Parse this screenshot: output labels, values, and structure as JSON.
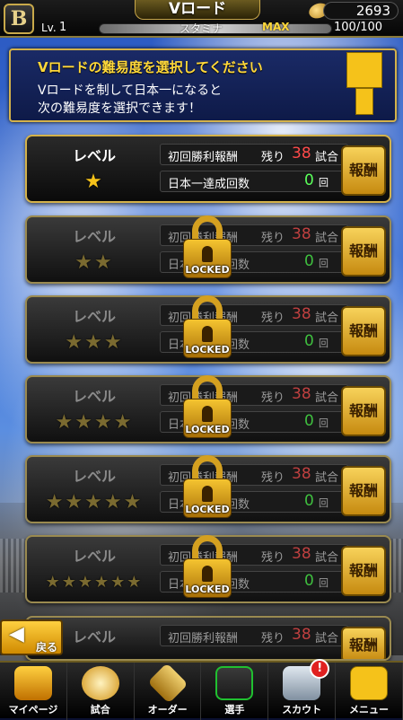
{
  "header": {
    "logo": "B",
    "title": "Vロード",
    "coins": "2693",
    "level_label": "Lv.",
    "level_value": "1",
    "stamina_label": "スタミナ",
    "stamina_max": "MAX",
    "stamina_value": "100/100"
  },
  "info": {
    "heading": "Vロードの難易度を選択してください",
    "line1": "Vロードを制して日本一になると",
    "line2": "次の難易度を選択できます！"
  },
  "levels": [
    {
      "label": "レベル",
      "stars": "★",
      "row1_label": "初回勝利報酬",
      "remaining_label": "残り",
      "remaining": "38",
      "remaining_unit": "試合",
      "row2_label": "日本一達成回数",
      "wins": "0",
      "wins_unit": "回",
      "reward": "報酬"
    },
    {
      "label": "レベル",
      "stars": "★★",
      "row1_label": "初回勝利報酬",
      "remaining_label": "残り",
      "remaining": "38",
      "remaining_unit": "試合",
      "row2_label": "日本一達成回数",
      "wins": "0",
      "wins_unit": "回",
      "reward": "報酬",
      "locked": "LOCKED"
    },
    {
      "label": "レベル",
      "stars": "★★★",
      "row1_label": "初回勝利報酬",
      "remaining_label": "残り",
      "remaining": "38",
      "remaining_unit": "試合",
      "row2_label": "日本一達成回数",
      "wins": "0",
      "wins_unit": "回",
      "reward": "報酬",
      "locked": "LOCKED"
    },
    {
      "label": "レベル",
      "stars": "★★★★",
      "row1_label": "初回勝利報酬",
      "remaining_label": "残り",
      "remaining": "38",
      "remaining_unit": "試合",
      "row2_label": "日本一達成回数",
      "wins": "0",
      "wins_unit": "回",
      "reward": "報酬",
      "locked": "LOCKED"
    },
    {
      "label": "レベル",
      "stars": "★★★★★",
      "row1_label": "初回勝利報酬",
      "remaining_label": "残り",
      "remaining": "38",
      "remaining_unit": "試合",
      "row2_label": "日本一達成回数",
      "wins": "0",
      "wins_unit": "回",
      "reward": "報酬",
      "locked": "LOCKED"
    },
    {
      "label": "レベル",
      "stars": "★★★★★★",
      "row1_label": "初回勝利報酬",
      "remaining_label": "残り",
      "remaining": "38",
      "remaining_unit": "試合",
      "row2_label": "日本一達成回数",
      "wins": "0",
      "wins_unit": "回",
      "reward": "報酬",
      "locked": "LOCKED"
    },
    {
      "label": "レベル",
      "stars": "",
      "row1_label": "初回勝利報酬",
      "remaining_label": "残り",
      "remaining": "38",
      "remaining_unit": "試合",
      "row2_label": "",
      "wins": "",
      "wins_unit": "",
      "reward": "報酬",
      "locked": ""
    }
  ],
  "back_label": "戻る",
  "nav": [
    {
      "label": "マイページ",
      "icon": "home-icon"
    },
    {
      "label": "試合",
      "icon": "baseball-icon"
    },
    {
      "label": "オーダー",
      "icon": "field-icon"
    },
    {
      "label": "選手",
      "icon": "player-icon"
    },
    {
      "label": "スカウト",
      "icon": "scout-icon",
      "badge": "!"
    },
    {
      "label": "メニュー",
      "icon": "mascot-icon"
    }
  ],
  "colors": {
    "accent": "#d4b24a",
    "remaining": "#ff4a4a",
    "wins": "#5aff5a",
    "reward": "#f5c21a"
  }
}
